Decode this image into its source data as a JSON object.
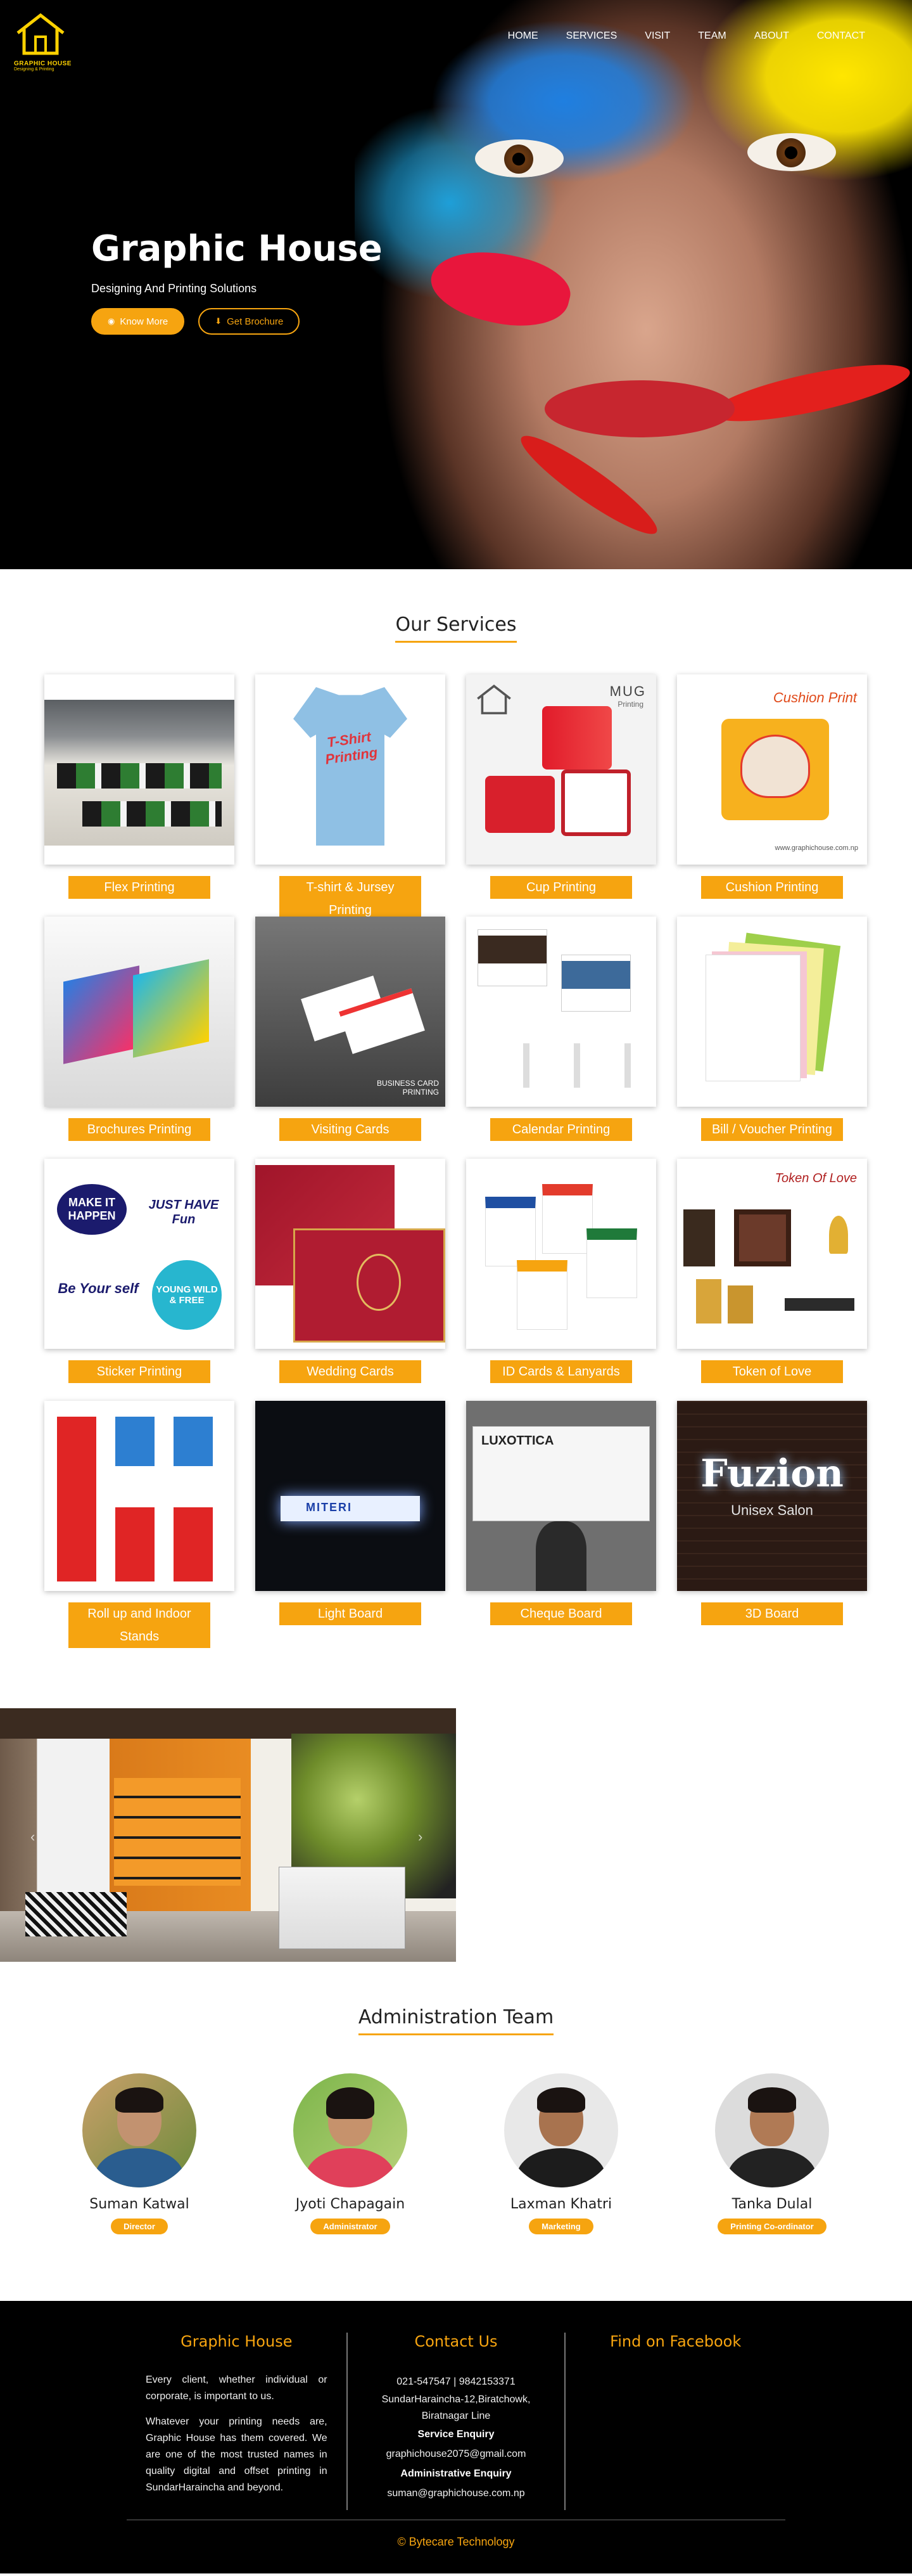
{
  "brand": {
    "logo_text": "GRAPHIC HOUSE",
    "logo_sub": "Designing & Printing"
  },
  "nav": {
    "items": [
      "HOME",
      "SERVICES",
      "VISIT",
      "TEAM",
      "ABOUT",
      "CONTACT"
    ]
  },
  "hero": {
    "title": "Graphic House",
    "subtitle": "Designing And Printing Solutions",
    "primary_button": "Know More",
    "secondary_button": "Get Brochure"
  },
  "services": {
    "heading": "Our Services",
    "items": [
      {
        "label": "Flex Printing"
      },
      {
        "label": "T-shirt & Jursey Printing"
      },
      {
        "label": "Cup Printing"
      },
      {
        "label": "Cushion Printing"
      },
      {
        "label": "Brochures Printing"
      },
      {
        "label": "Visiting Cards"
      },
      {
        "label": "Calendar Printing"
      },
      {
        "label": "Bill / Voucher Printing"
      },
      {
        "label": "Sticker Printing"
      },
      {
        "label": "Wedding Cards"
      },
      {
        "label": "ID Cards & Lanyards"
      },
      {
        "label": "Token of Love"
      },
      {
        "label": "Roll up and Indoor Stands"
      },
      {
        "label": "Light Board"
      },
      {
        "label": "Cheque Board"
      },
      {
        "label": "3D Board"
      }
    ],
    "image_text": {
      "tshirt": "T-Shirt Printing",
      "mug": "MUG",
      "mug_sub": "Printing",
      "cushion": "Cushion Print",
      "cushion_url": "www.graphichouse.com.np",
      "visiting": "BUSINESS CARD PRINTING",
      "sticker_1": "MAKE IT HAPPEN",
      "sticker_2": "JUST HAVE Fun",
      "sticker_3": "Be Your self",
      "sticker_4": "YOUNG WILD & FREE",
      "token": "Token Of Love",
      "light": "MITERI",
      "cheque": "LUXOTTICA",
      "board3d": "Fuzion",
      "board3d_sub": "Unisex Salon"
    }
  },
  "team": {
    "heading": "Administration Team",
    "members": [
      {
        "name": "Suman Katwal",
        "role": "Director"
      },
      {
        "name": "Jyoti Chapagain",
        "role": "Administrator"
      },
      {
        "name": "Laxman Khatri",
        "role": "Marketing"
      },
      {
        "name": "Tanka Dulal",
        "role": "Printing Co-ordinator"
      }
    ]
  },
  "footer": {
    "col1_title": "Graphic House",
    "col1_p1": "Every client, whether individual or corporate, is important to us.",
    "col1_p2": "Whatever your printing needs are, Graphic House has them covered. We are one of the most trusted names in quality digital and offset printing in SundarHaraincha and beyond.",
    "col2_title": "Contact Us",
    "phone": "021-547547 | 9842153371",
    "address1": "SundarHaraincha-12,Biratchowk,",
    "address2": "Biratnagar Line",
    "service_label": "Service Enquiry",
    "service_email": "graphichouse2075@gmail.com",
    "admin_label": "Administrative Enquiry",
    "admin_email": "suman@graphichouse.com.np",
    "col3_title": "Find on Facebook",
    "copyright": "© Bytecare Technology"
  },
  "colors": {
    "accent": "#f6a410",
    "footer_bg": "#000000"
  }
}
